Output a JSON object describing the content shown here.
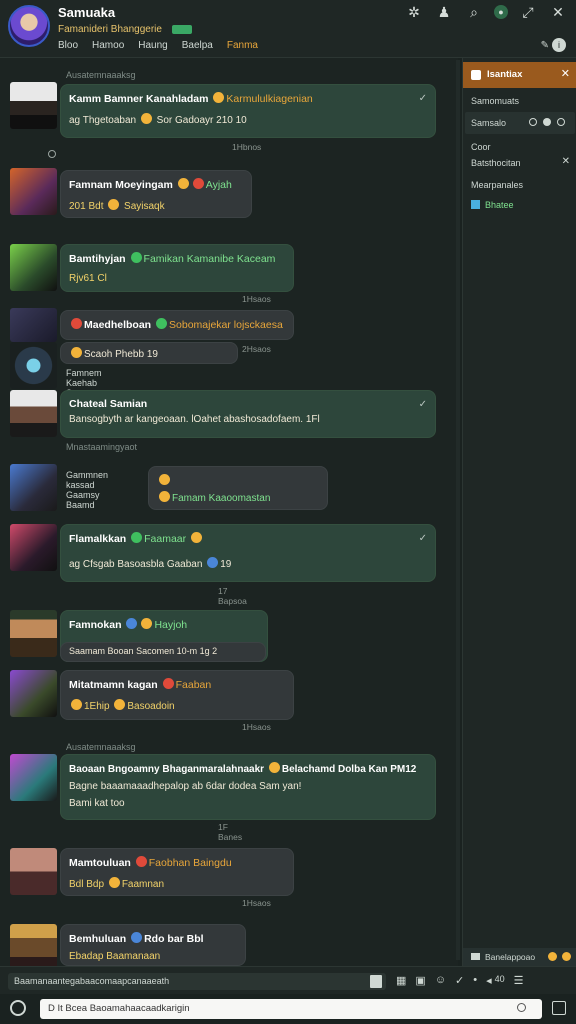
{
  "header": {
    "title": "Samuaka",
    "subtitle": "Famanideri Bhanggerie",
    "nav": [
      "Bloo",
      "Hamoo",
      "Haung",
      "Baelpa",
      "Fanma"
    ],
    "icons": [
      "settings-icon",
      "notification-icon",
      "search-icon",
      "status-icon",
      "expand-icon",
      "close-icon"
    ]
  },
  "chat": {
    "date_top": "Ausatemnaaaksg",
    "date_mid": "Mnastaamingyaot",
    "messages": [
      {
        "name": "Kamm Bamner Kanahladam",
        "tag": "Karmululkiagenian",
        "text": "ag Thgetoaban",
        "text2": "Sor Gadoayr 210 10",
        "time": "1Hbnos"
      },
      {
        "name": "Famnam Moeyingam",
        "tag": "Ayjah",
        "text": "201 Bdt",
        "text2": "Sayisaqk",
        "time": ""
      },
      {
        "name": "Bamtihyjan",
        "tag": "Famikan Kamanibe Kaceam",
        "text": "Rjv61 Cl",
        "text2": "",
        "time": "1Hsaos"
      },
      {
        "name": "Maedhelboan",
        "tag": "Sobomajekar lojsckaesa",
        "text": "Scaoh Phebb 19",
        "text2": "",
        "time": "2Hsaos"
      },
      {
        "name": "",
        "tag": "",
        "text": "Famnem Kaehab Sano",
        "text2": "",
        "time": ""
      },
      {
        "name": "Chateal Samian",
        "tag": "",
        "text": "Bansogbyth ar kangeoaan. lOahet abashosadofaem. 1Fl",
        "text2": "",
        "time": ""
      },
      {
        "name": "Gammnen kassad",
        "tag": "",
        "text": "Gaamsy Baamd",
        "text2": "Famam Kaaoomastan",
        "time": ""
      },
      {
        "name": "Flamalkkan",
        "tag": "Faamaar",
        "text": "ag Cfsgab Basoasbla Gaaban",
        "text2": "19",
        "time": "17 Bapsoa"
      },
      {
        "name": "Famnokan",
        "tag": "Hayjoh",
        "text": "Saamam Booan",
        "text2": "Sacomen 10-m 1g 2",
        "time": ""
      },
      {
        "name": "Mitatmamn kagan",
        "tag": "Faaban",
        "text": "1Ehip",
        "text2": "Basoadoin",
        "time": "1Hsaos"
      },
      {
        "name": "Baoaan Bngoamny Bhaganmaralahnaakr",
        "tag": "Belachamd Dolba Kan PM12",
        "text": "Bagne baaamaaadhepalop ab 6dar dodea Sam yan!",
        "text2": "Bami kat too",
        "time": "1F Banes"
      },
      {
        "name": "Mamtouluan",
        "tag": "Faobhan Baingdu",
        "text": "Bdl Bdp",
        "text2": "Faamnan",
        "time": "1Hsaos"
      },
      {
        "name": "Bemhuluan",
        "tag": "Rdo bar Bbl",
        "text": "Ebadap Baamanaan",
        "text2": "",
        "time": ""
      }
    ]
  },
  "sidebar": {
    "header": "Isantiax",
    "row1": "Samomuats",
    "row2": "Samsalo",
    "row3_label": "Coor",
    "row3_value": "Batsthocitan",
    "row4": "Mearpanales",
    "row5": "Bhatee",
    "bottom": "Banelappoao"
  },
  "toolbar": {
    "command": "Baamanaantegabaacomaapcanaaeath",
    "tools": [
      "file-icon",
      "grid-icon",
      "image-icon",
      "emoji-icon",
      "check-icon",
      "more-icon",
      "volume-icon",
      "menu-icon"
    ],
    "volume": "40"
  },
  "composer": {
    "placeholder": "D It Bcea Baoamahaacaadkarigin"
  }
}
